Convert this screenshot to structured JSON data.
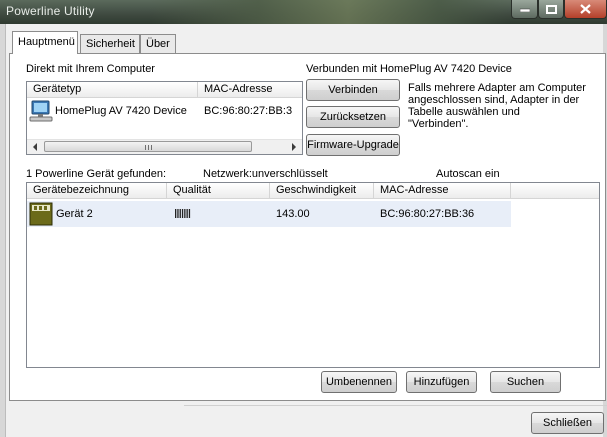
{
  "window": {
    "title": "Powerline Utility",
    "close_label": "Schließen"
  },
  "tabs": [
    {
      "label": "Hauptmenü",
      "active": true
    },
    {
      "label": "Sicherheit",
      "active": false
    },
    {
      "label": "Über",
      "active": false
    }
  ],
  "direct": {
    "heading": "Direkt mit Ihrem Computer",
    "columns": [
      "Gerätetyp",
      "MAC-Adresse"
    ],
    "rows": [
      {
        "type": "HomePlug AV 7420 Device",
        "mac": "BC:96:80:27:BB:3",
        "icon": "computer-icon"
      }
    ]
  },
  "connected": {
    "heading": "Verbunden mit HomePlug AV 7420 Device",
    "buttons": {
      "connect": "Verbinden",
      "reset": "Zurücksetzen",
      "firmware": "Firmware-Upgrade"
    },
    "hint": [
      "Falls mehrere Adapter am Computer",
      "angeschlossen sind, Adapter in der",
      "Tabelle auswählen und",
      "\"Verbinden\"."
    ]
  },
  "status": {
    "found": "1 Powerline Gerät gefunden:",
    "network": "Netzwerk:unverschlüsselt",
    "autoscan": "Autoscan ein"
  },
  "devices": {
    "columns": [
      "Gerätebezeichnung",
      "Qualität",
      "Geschwindigkeit",
      "MAC-Adresse"
    ],
    "rows": [
      {
        "name": "Gerät 2",
        "quality_bars": 7,
        "speed": "143.00",
        "mac": "BC:96:80:27:BB:36",
        "icon": "powerline-adapter-icon"
      }
    ]
  },
  "actions": {
    "rename": "Umbenennen",
    "add": "Hinzufügen",
    "search": "Suchen"
  },
  "colors": {
    "selection": "#e8eef8",
    "adapter_icon": "#6b6a1a"
  }
}
